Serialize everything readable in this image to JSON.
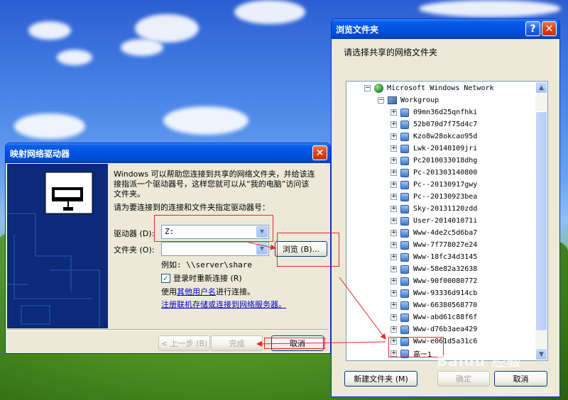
{
  "map_dialog": {
    "title": "映射网络驱动器",
    "close_glyph": "✕",
    "intro": "Windows 可以帮助您连接到共享的网络文件夹，并给该连接指派一个驱动器号，这样您就可以从“我的电脑”访问该文件夹。",
    "instruction": "请为要连接到的连接和文件夹指定驱动器号：",
    "drive_label": "驱动器 (D):",
    "drive_value": "Z:",
    "folder_label": "文件夹 (O):",
    "folder_value": "",
    "browse_label": "浏览 (B)...",
    "example": "例如: \\\\server\\share",
    "reconnect_label": "登录时重新连接 (R)",
    "reconnect_checked": true,
    "other_user_prefix": "使用",
    "other_user_link": "其他用户名",
    "other_user_suffix": "进行连接。",
    "register_link": "注册联机存储或连接到网络服务器。",
    "back_label": "< 上一步 (B)",
    "finish_label": "完成",
    "cancel_label": "取消"
  },
  "browse_dialog": {
    "title": "浏览文件夹",
    "help_glyph": "?",
    "close_glyph": "✕",
    "prompt": "请选择共享的网络文件夹",
    "tree_root": "Microsoft Windows Network",
    "tree_group": "Workgroup",
    "computers": [
      "09mn36d25qnfhki",
      "52b070d7f75d4c7",
      "Kzo8w28okcao95d",
      "Lwk-20140109jri",
      "Pc2010033018dhg",
      "Pc-201303140800",
      "Pc--20130917gwy",
      "Pc--20130923bea",
      "Sky-20131120zdd",
      "User-201401071i",
      "Www-4de2c5d6ba7",
      "Www-7f778027e24",
      "Www-18fc34d3145",
      "Www-58e82a32638",
      "Www-90f00080772",
      "Www-93336d914cb",
      "Www-66380568770",
      "Www-abd61c88f6f",
      "Www-d76b3aea429",
      "Www-e061d5a31c6",
      "高一1"
    ],
    "new_folder_label": "新建文件夹 (M)",
    "ok_label": "确定",
    "cancel_label": "取消"
  },
  "watermark": "Baidu 经验",
  "watermark_url": "jingyan.baidu.com",
  "colors": {
    "xp_blue": "#0054e3",
    "annotation_red": "#e32b2b",
    "dialog_bg": "#ece9d8"
  }
}
